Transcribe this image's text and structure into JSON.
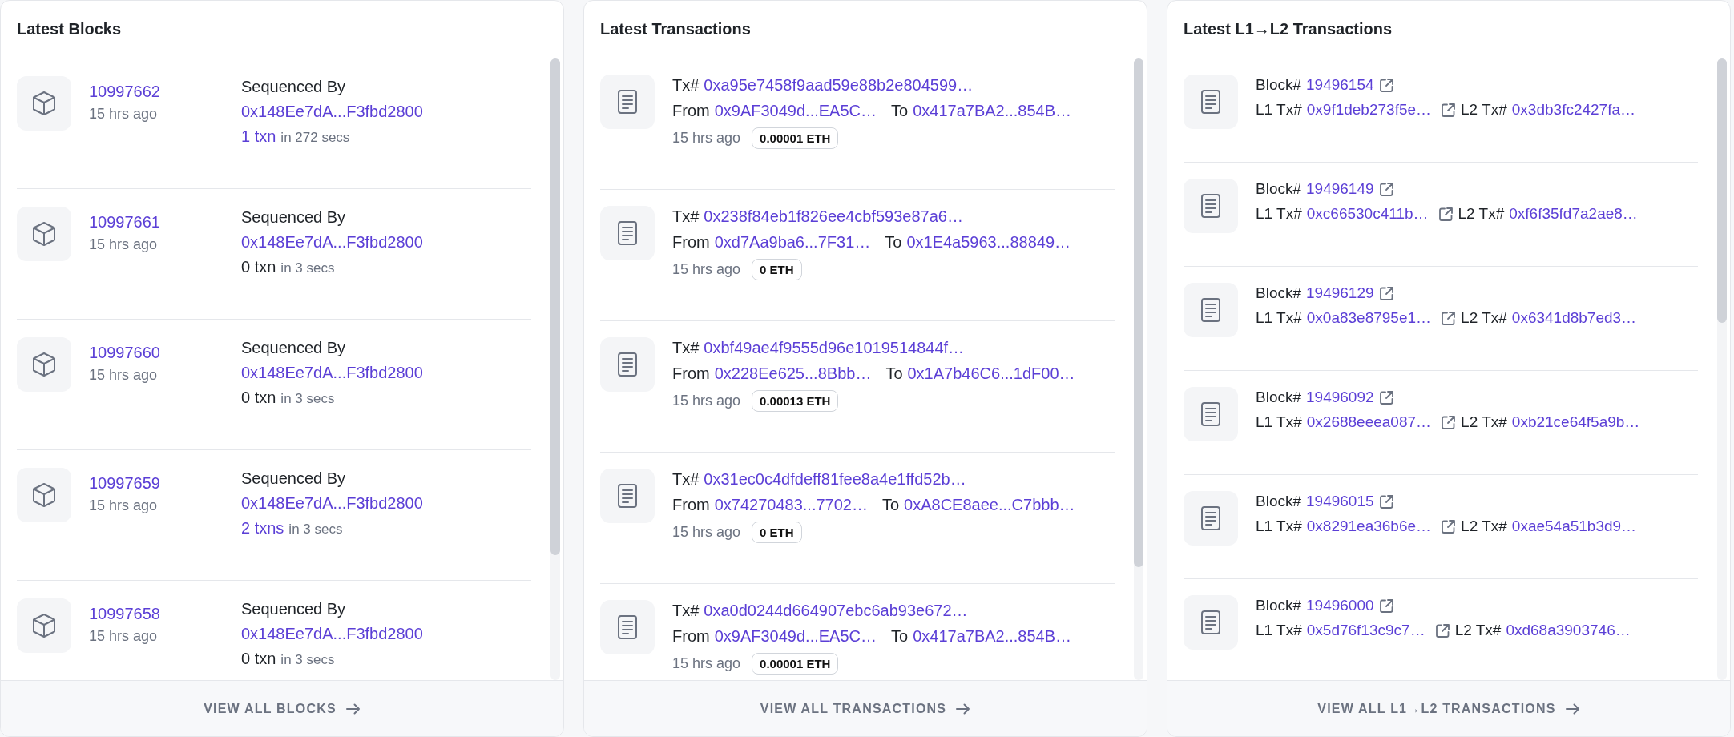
{
  "blocks_panel": {
    "title": "Latest Blocks",
    "rows": [
      {
        "number": "10997662",
        "age": "15 hrs ago",
        "sequenced_label": "Sequenced By",
        "sequencer": "0x148Ee7dA...F3fbd2800",
        "txn_count": "1 txn",
        "txn_linked": true,
        "duration": "in 272 secs"
      },
      {
        "number": "10997661",
        "age": "15 hrs ago",
        "sequenced_label": "Sequenced By",
        "sequencer": "0x148Ee7dA...F3fbd2800",
        "txn_count": "0 txn",
        "txn_linked": false,
        "duration": "in 3 secs"
      },
      {
        "number": "10997660",
        "age": "15 hrs ago",
        "sequenced_label": "Sequenced By",
        "sequencer": "0x148Ee7dA...F3fbd2800",
        "txn_count": "0 txn",
        "txn_linked": false,
        "duration": "in 3 secs"
      },
      {
        "number": "10997659",
        "age": "15 hrs ago",
        "sequenced_label": "Sequenced By",
        "sequencer": "0x148Ee7dA...F3fbd2800",
        "txn_count": "2 txns",
        "txn_linked": true,
        "duration": "in 3 secs"
      },
      {
        "number": "10997658",
        "age": "15 hrs ago",
        "sequenced_label": "Sequenced By",
        "sequencer": "0x148Ee7dA...F3fbd2800",
        "txn_count": "0 txn",
        "txn_linked": false,
        "duration": "in 3 secs"
      }
    ],
    "footer": "VIEW ALL BLOCKS"
  },
  "transactions_panel": {
    "title": "Latest Transactions",
    "rows": [
      {
        "tx_label": "Tx#",
        "hash": "0xa95e7458f9aad59e88b2e804599…",
        "from_label": "From",
        "from": "0x9AF3049d...EA5C…",
        "to_label": "To",
        "to": "0x417a7BA2...854B…",
        "age": "15 hrs ago",
        "value": "0.00001 ETH"
      },
      {
        "tx_label": "Tx#",
        "hash": "0x238f84eb1f826ee4cbf593e87a6…",
        "from_label": "From",
        "from": "0xd7Aa9ba6...7F31…",
        "to_label": "To",
        "to": "0x1E4a5963...88849…",
        "age": "15 hrs ago",
        "value": "0 ETH"
      },
      {
        "tx_label": "Tx#",
        "hash": "0xbf49ae4f9555d96e1019514844f…",
        "from_label": "From",
        "from": "0x228Ee625...8Bbb…",
        "to_label": "To",
        "to": "0x1A7b46C6...1dF00…",
        "age": "15 hrs ago",
        "value": "0.00013 ETH"
      },
      {
        "tx_label": "Tx#",
        "hash": "0x31ec0c4dfdeff81fee8a4e1ffd52b…",
        "from_label": "From",
        "from": "0x74270483...7702…",
        "to_label": "To",
        "to": "0xA8CE8aee...C7bbb…",
        "age": "15 hrs ago",
        "value": "0 ETH"
      },
      {
        "tx_label": "Tx#",
        "hash": "0xa0d0244d664907ebc6ab93e672…",
        "from_label": "From",
        "from": "0x9AF3049d...EA5C…",
        "to_label": "To",
        "to": "0x417a7BA2...854B…",
        "age": "15 hrs ago",
        "value": "0.00001 ETH"
      }
    ],
    "footer": "VIEW ALL TRANSACTIONS"
  },
  "deposits_panel": {
    "title": "Latest L1→L2 Transactions",
    "rows": [
      {
        "block_label": "Block#",
        "block": "19496154",
        "l1_label": "L1 Tx#",
        "l1_tx": "0x9f1deb273f5e…",
        "l2_label": "L2 Tx#",
        "l2_tx": "0x3db3fc2427fa…"
      },
      {
        "block_label": "Block#",
        "block": "19496149",
        "l1_label": "L1 Tx#",
        "l1_tx": "0xc66530c411b…",
        "l2_label": "L2 Tx#",
        "l2_tx": "0xf6f35fd7a2ae8…"
      },
      {
        "block_label": "Block#",
        "block": "19496129",
        "l1_label": "L1 Tx#",
        "l1_tx": "0x0a83e8795e1…",
        "l2_label": "L2 Tx#",
        "l2_tx": "0x6341d8b7ed3…"
      },
      {
        "block_label": "Block#",
        "block": "19496092",
        "l1_label": "L1 Tx#",
        "l1_tx": "0x2688eeea087…",
        "l2_label": "L2 Tx#",
        "l2_tx": "0xb21ce64f5a9b…"
      },
      {
        "block_label": "Block#",
        "block": "19496015",
        "l1_label": "L1 Tx#",
        "l1_tx": "0x8291ea36b6e…",
        "l2_label": "L2 Tx#",
        "l2_tx": "0xae54a51b3d9…"
      },
      {
        "block_label": "Block#",
        "block": "19496000",
        "l1_label": "L1 Tx#",
        "l1_tx": "0x5d76f13c9c7…",
        "l2_label": "L2 Tx#",
        "l2_tx": "0xd68a3903746…"
      }
    ],
    "footer": "VIEW ALL L1→L2 TRANSACTIONS"
  }
}
